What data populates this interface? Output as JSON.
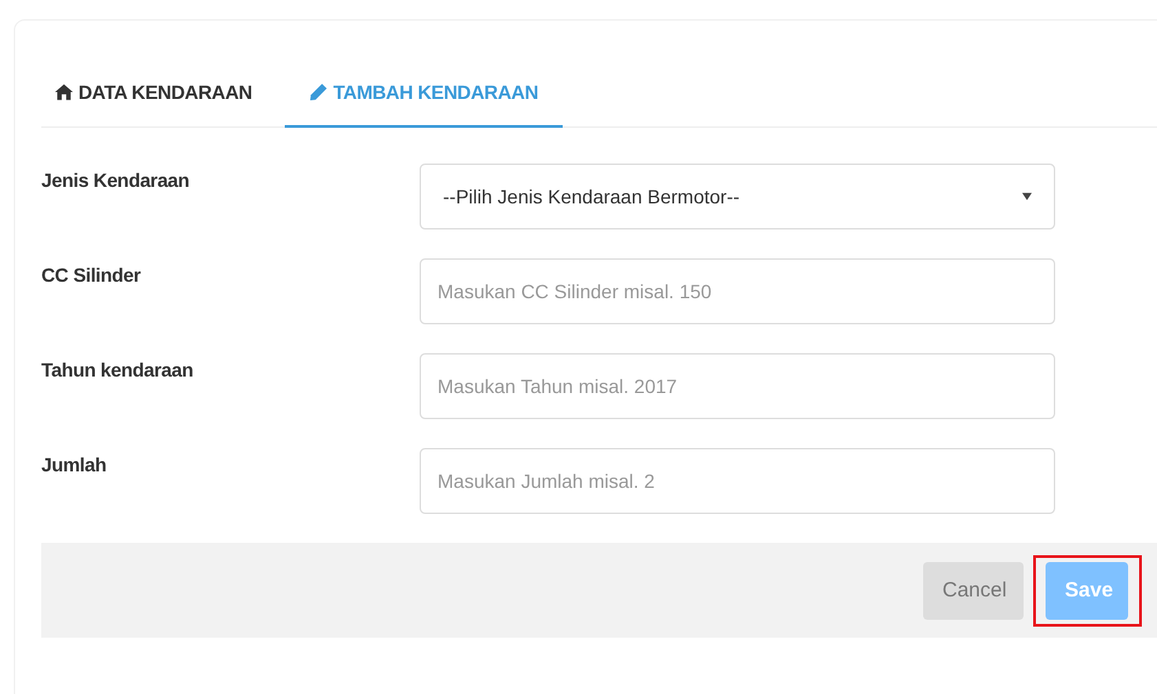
{
  "tabs": [
    {
      "label": "DATA KENDARAAN",
      "kind": "list",
      "selected": false
    },
    {
      "label": "TAMBAH KENDARAAN",
      "kind": "add",
      "selected": true
    }
  ],
  "fields": [
    {
      "label": "Jenis Kendaraan",
      "kind": "select",
      "value": "--Pilih Jenis Kendaraan Bermotor--"
    },
    {
      "label": "CC Silinder",
      "kind": "input",
      "placeholder": "Masukan CC Silinder misal. 150"
    },
    {
      "label": "Tahun kendaraan",
      "kind": "input",
      "placeholder": "Masukan Tahun misal. 2017"
    },
    {
      "label": "Jumlah",
      "kind": "input",
      "placeholder": "Masukan Jumlah misal. 2"
    }
  ],
  "buttons": [
    {
      "label": "Cancel",
      "kind": "cancel",
      "highlighted": false
    },
    {
      "label": "Save",
      "kind": "save",
      "highlighted": true
    }
  ]
}
